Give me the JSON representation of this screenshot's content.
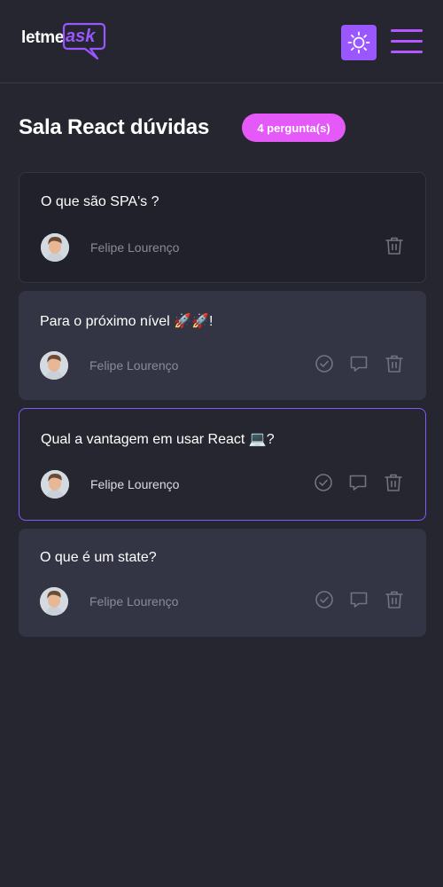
{
  "header": {
    "logo": {
      "text_letme": "letme",
      "text_ask": "ask"
    },
    "theme_toggle_icon": "sun-icon",
    "menu_icon": "hamburger-menu-icon"
  },
  "room": {
    "title": "Sala React dúvidas",
    "question_count_label": "4 pergunta(s)"
  },
  "colors": {
    "background": "#262630",
    "card": "#333544",
    "card_answered": "#21212b",
    "accent_purple": "#9a56ff",
    "badge_pink": "#e559f9",
    "highlight_border": "#835afd",
    "icon_gray": "#737380"
  },
  "questions": [
    {
      "content": "O que são SPA's ?",
      "author": "Felipe Lourenço",
      "state": "answered",
      "actions": [
        "delete-icon"
      ]
    },
    {
      "content": "Para o próximo nível 🚀🚀!",
      "author": "Felipe Lourenço",
      "state": "default",
      "actions": [
        "check-circle-icon",
        "answer-icon",
        "delete-icon"
      ]
    },
    {
      "content": "Qual a vantagem em usar React 💻?",
      "author": "Felipe Lourenço",
      "state": "highlighted",
      "actions": [
        "check-circle-icon",
        "answer-icon",
        "delete-icon"
      ]
    },
    {
      "content": "O que é um state?",
      "author": "Felipe Lourenço",
      "state": "default",
      "actions": [
        "check-circle-icon",
        "answer-icon",
        "delete-icon"
      ]
    }
  ]
}
